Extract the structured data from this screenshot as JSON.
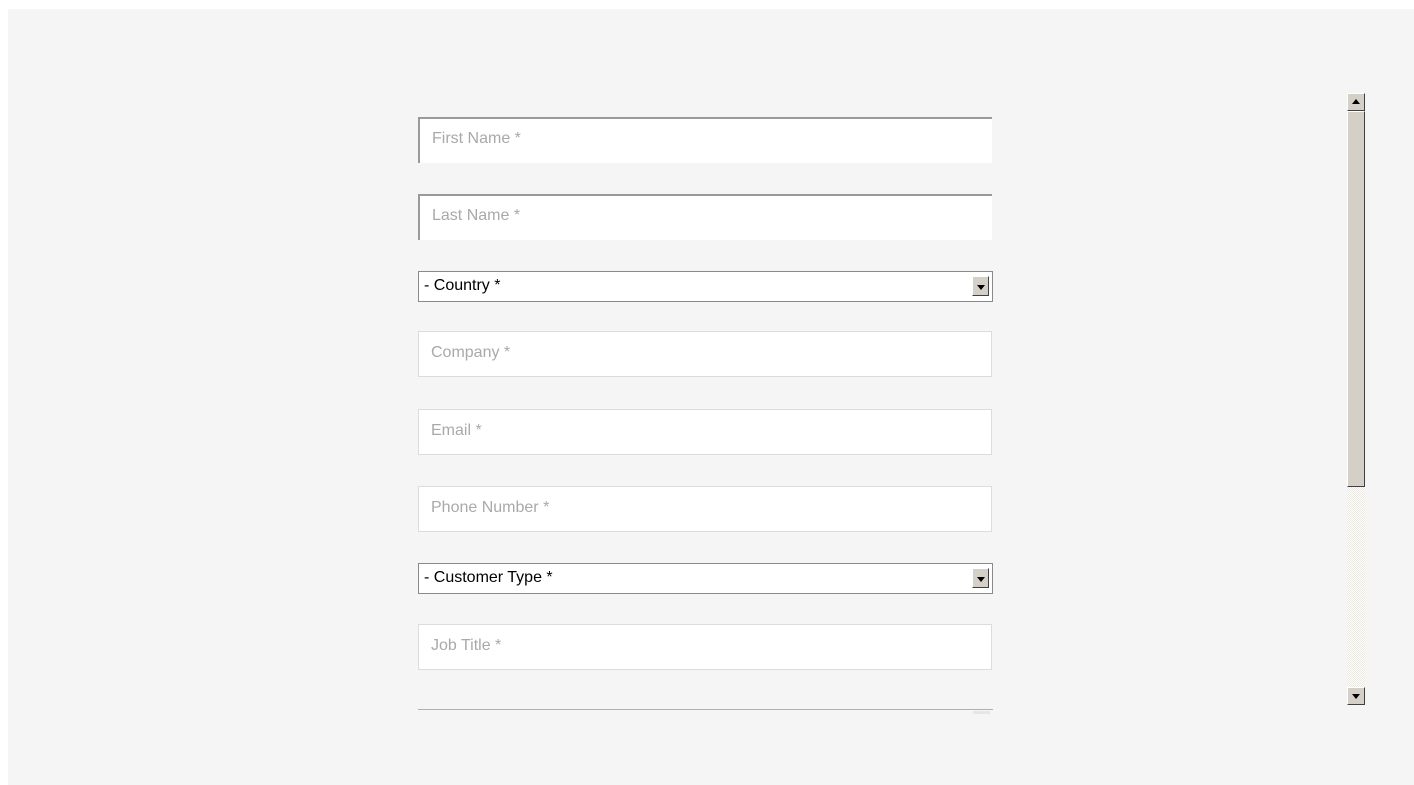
{
  "form": {
    "first_name_placeholder": "First Name *",
    "last_name_placeholder": "Last Name *",
    "country_selected": "- Country *",
    "company_placeholder": "Company *",
    "email_placeholder": "Email *",
    "phone_placeholder": "Phone Number *",
    "customer_type_selected": "- Customer Type *",
    "job_title_placeholder": "Job Title *"
  },
  "scrollbar": {
    "scroll_fraction": 0,
    "visible_fraction": 0.65
  },
  "colors": {
    "page_background": "#f4f5f4",
    "field_background": "#ffffff",
    "placeholder_text": "#a9a9a9",
    "scrollbar_face": "#d4d0c8"
  },
  "icons": [
    "chevron-down-icon",
    "arrow-up-icon",
    "arrow-down-icon"
  ]
}
